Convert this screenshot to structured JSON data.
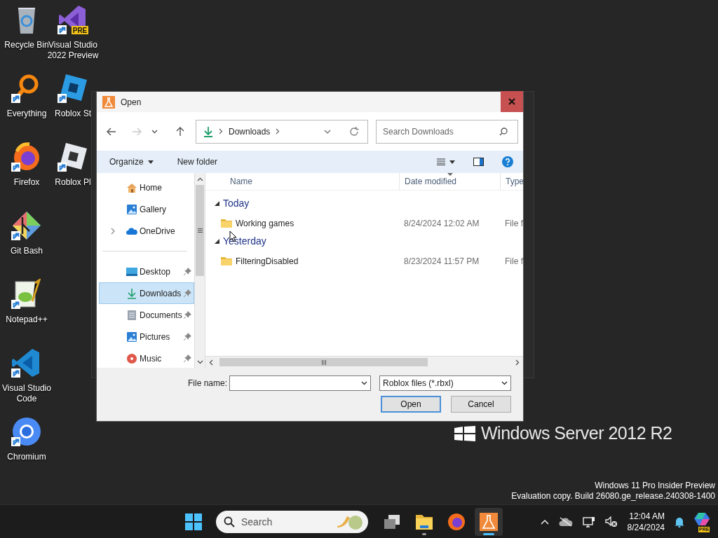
{
  "desktop_icons": [
    {
      "label": "Recycle Bin",
      "kind": "recycle",
      "shortcut": false
    },
    {
      "label": "Everything",
      "kind": "search",
      "shortcut": true
    },
    {
      "label": "Firefox",
      "kind": "firefox",
      "shortcut": true
    },
    {
      "label": "Git Bash",
      "kind": "git",
      "shortcut": true
    },
    {
      "label": "Notepad++",
      "kind": "notepad",
      "shortcut": true
    },
    {
      "label": "Visual Studio Code",
      "kind": "code",
      "shortcut": true
    },
    {
      "label": "Chromium",
      "kind": "chromium",
      "shortcut": true
    },
    {
      "label": "Visual Studio 2022 Preview",
      "kind": "studio",
      "shortcut": true,
      "badge": "PRE"
    },
    {
      "label": "Roblox St",
      "kind": "roblox",
      "shortcut": true
    },
    {
      "label": "Roblox Pl",
      "kind": "player",
      "shortcut": true
    }
  ],
  "server_brand": "Windows Server 2012 R2",
  "activation_text": [
    "Windows 11 Pro Insider Preview",
    "Evaluation copy. Build 26080.ge_release.240308-1400"
  ],
  "dialog": {
    "title": "Open",
    "address": {
      "location": "Downloads"
    },
    "search": {
      "placeholder": "Search Downloads"
    },
    "toolbar": {
      "organize": "Organize",
      "new_folder": "New folder"
    },
    "nav_pane": {
      "sections": [
        {
          "items": [
            {
              "label": "Home",
              "kind": "home",
              "expandable": false,
              "pinned": false,
              "selected": false
            },
            {
              "label": "Gallery",
              "kind": "gallery",
              "expandable": false,
              "pinned": false,
              "selected": false
            },
            {
              "label": "OneDrive",
              "kind": "cloud",
              "expandable": true,
              "pinned": false,
              "selected": false
            }
          ]
        },
        {
          "items": [
            {
              "label": "Desktop",
              "kind": "desktop",
              "expandable": false,
              "pinned": true,
              "selected": false
            },
            {
              "label": "Downloads",
              "kind": "downloads",
              "expandable": false,
              "pinned": true,
              "selected": true
            },
            {
              "label": "Documents",
              "kind": "documents",
              "expandable": false,
              "pinned": true,
              "selected": false
            },
            {
              "label": "Pictures",
              "kind": "gallery",
              "expandable": false,
              "pinned": true,
              "selected": false
            },
            {
              "label": "Music",
              "kind": "music",
              "expandable": false,
              "pinned": true,
              "selected": false
            }
          ]
        }
      ]
    },
    "columns": [
      "Name",
      "Date modified",
      "Type"
    ],
    "groups": [
      {
        "label": "Today",
        "expanded": true,
        "files": [
          {
            "name": "Working games",
            "date": "8/24/2024 12:02 AM",
            "type": "File f"
          }
        ]
      },
      {
        "label": "Yesterday",
        "expanded": true,
        "files": [
          {
            "name": "FilteringDisabled",
            "date": "8/23/2024 11:57 PM",
            "type": "File f"
          }
        ]
      }
    ],
    "file_name_label": "File name:",
    "file_type": "Roblox files (*.rbxl)",
    "buttons": [
      {
        "label": "Open",
        "kind": "default"
      },
      {
        "label": "Cancel",
        "kind": "normal"
      }
    ]
  },
  "taskbar": {
    "search": {
      "placeholder": "Search"
    },
    "apps": [
      {
        "kind": "taskview",
        "running": false,
        "active": false
      },
      {
        "kind": "explorer",
        "running": true,
        "active": false
      },
      {
        "kind": "firefox",
        "running": false,
        "active": false
      },
      {
        "kind": "flask",
        "running": true,
        "active": true
      }
    ],
    "clock": {
      "time": "12:04 AM",
      "date": "8/24/2024"
    },
    "copilot_badge": "PRE"
  }
}
